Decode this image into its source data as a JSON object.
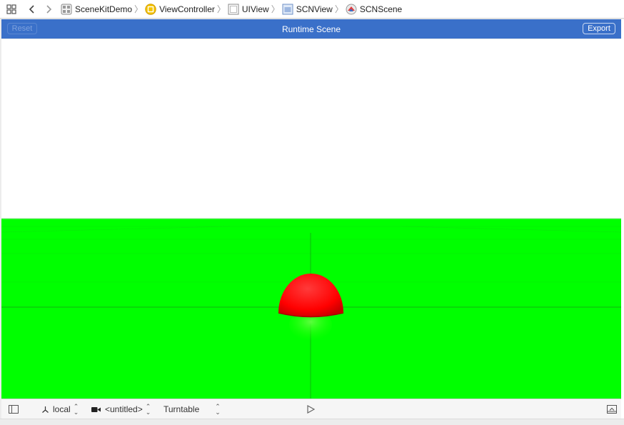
{
  "jumpbar": {
    "crumbs": [
      {
        "label": "SceneKitDemo",
        "icon": "project-icon"
      },
      {
        "label": "ViewController",
        "icon": "view-controller-icon"
      },
      {
        "label": "UIView",
        "icon": "uiview-icon"
      },
      {
        "label": "SCNView",
        "icon": "scnview-icon"
      },
      {
        "label": "SCNScene",
        "icon": "scnscene-icon"
      }
    ]
  },
  "scene_header": {
    "title": "Runtime Scene",
    "reset_label": "Reset",
    "export_label": "Export"
  },
  "viewport": {
    "floor_color": "#00ff00",
    "sphere_color": "#ff0000",
    "background_color": "#ffffff"
  },
  "bottom_toolbar": {
    "coordinate_space": "local",
    "camera": "<untitled>",
    "camera_mode": "Turntable"
  }
}
